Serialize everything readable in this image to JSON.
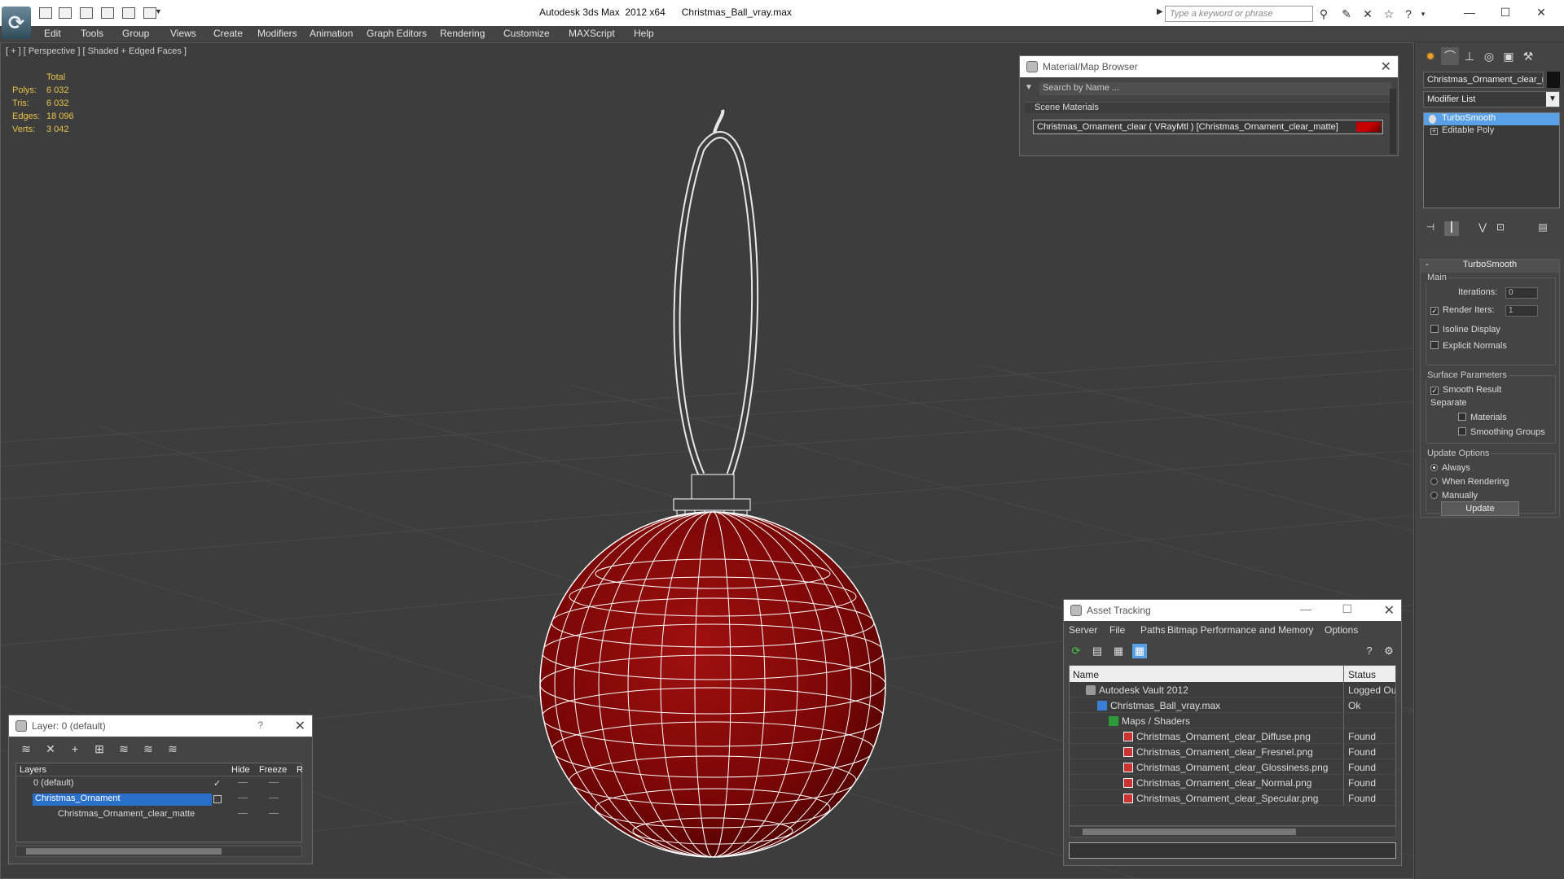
{
  "app": {
    "title": "Autodesk 3ds Max  2012 x64      Christmas_Ball_vray.max",
    "search_placeholder": "Type a keyword or phrase"
  },
  "menu": [
    "Edit",
    "Tools",
    "Group",
    "Views",
    "Create",
    "Modifiers",
    "Animation",
    "Graph Editors",
    "Rendering",
    "Customize",
    "MAXScript",
    "Help"
  ],
  "viewport": {
    "label": "[ + ] [ Perspective ] [ Shaded + Edged Faces ]",
    "stats": {
      "header": "Total",
      "rows": [
        {
          "k": "Polys:",
          "v": "6 032"
        },
        {
          "k": "Tris:",
          "v": "6 032"
        },
        {
          "k": "Edges:",
          "v": "18 096"
        },
        {
          "k": "Verts:",
          "v": "3 042"
        }
      ]
    },
    "colors": {
      "ornament": "#8a0a0a",
      "wire": "#ffffff",
      "grid": "#4a4a4a"
    }
  },
  "material_browser": {
    "title": "Material/Map Browser",
    "search": "Search by Name ...",
    "group": "Scene Materials",
    "material": "Christmas_Ornament_clear  ( VRayMtl )  [Christmas_Ornament_clear_matte]"
  },
  "command_panel": {
    "object_name": "Christmas_Ornament_clear_m",
    "modifier_list": "Modifier List",
    "stack": [
      {
        "label": "TurboSmooth",
        "selected": true
      },
      {
        "label": "Editable Poly",
        "selected": false
      }
    ],
    "rollout": {
      "title": "TurboSmooth",
      "main": "Main",
      "iterations_label": "Iterations:",
      "iterations": "0",
      "render_iters_label": "Render Iters:",
      "render_iters": "1",
      "isoline": "Isoline Display",
      "explicit": "Explicit Normals",
      "surface_params": "Surface Parameters",
      "smooth_result": "Smooth Result",
      "separate": "Separate",
      "materials": "Materials",
      "smoothing_groups": "Smoothing Groups",
      "update_options": "Update Options",
      "always": "Always",
      "when_rendering": "When Rendering",
      "manually": "Manually",
      "update": "Update"
    }
  },
  "layer_panel": {
    "title": "Layer: 0 (default)",
    "help": "?",
    "columns": {
      "layers": "Layers",
      "hide": "Hide",
      "freeze": "Freeze",
      "r": "R"
    },
    "rows": [
      {
        "name": "0 (default)"
      },
      {
        "name": "Christmas_Ornament"
      },
      {
        "name": "Christmas_Ornament_clear_matte"
      }
    ]
  },
  "asset_tracking": {
    "title": "Asset Tracking",
    "menu": [
      "Server",
      "File",
      "Paths",
      "Bitmap Performance and Memory",
      "Options"
    ],
    "columns": {
      "name": "Name",
      "status": "Status"
    },
    "rows": [
      {
        "name": "Autodesk Vault 2012",
        "status": "Logged Out",
        "icon": "vault"
      },
      {
        "name": "Christmas_Ball_vray.max",
        "status": "Ok",
        "icon": "max"
      },
      {
        "name": "Maps / Shaders",
        "status": "",
        "icon": "maps"
      },
      {
        "name": "Christmas_Ornament_clear_Diffuse.png",
        "status": "Found",
        "icon": "png"
      },
      {
        "name": "Christmas_Ornament_clear_Fresnel.png",
        "status": "Found",
        "icon": "png"
      },
      {
        "name": "Christmas_Ornament_clear_Glossiness.png",
        "status": "Found",
        "icon": "png"
      },
      {
        "name": "Christmas_Ornament_clear_Normal.png",
        "status": "Found",
        "icon": "png"
      },
      {
        "name": "Christmas_Ornament_clear_Specular.png",
        "status": "Found",
        "icon": "png"
      }
    ]
  }
}
